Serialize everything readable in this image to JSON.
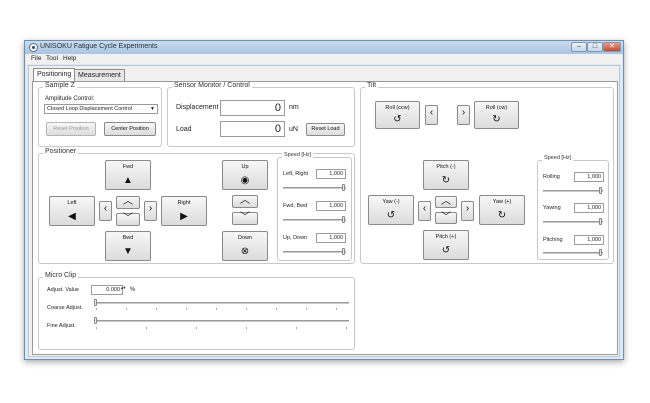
{
  "window": {
    "title": "UNISOKU Fatigue Cycle Experiments",
    "min_glyph": "–",
    "max_glyph": "□",
    "close_glyph": "✕"
  },
  "menu": [
    "File",
    "Tool",
    "Help"
  ],
  "tabs": [
    "Positioning",
    "Measurement"
  ],
  "sample_z": {
    "title": "Sample Z",
    "amp_label": "Amplitude Control:",
    "amp_value": "Closed Loop Displacement Control",
    "reset_position": "Reset Position",
    "center_position": "Center Position"
  },
  "sensor": {
    "title": "Sensor Monitor / Control",
    "displacement_label": "Displacement",
    "displacement_value": "0",
    "displacement_unit": "nm",
    "load_label": "Load",
    "load_value": "0",
    "load_unit": "uN",
    "reset_load": "Reset Load"
  },
  "tilt": {
    "title": "Tilt",
    "roll_ccw": "Roll (ccw)",
    "roll_cw": "Roll (cw)",
    "pitch_minus": "Pitch (-)",
    "pitch_plus": "Pitch (+)",
    "yaw_minus": "Yaw (-)",
    "yaw_plus": "Yaw (+)",
    "speed_title": "Speed [Hz]",
    "rolling_label": "Rolling",
    "rolling_value": "1,000",
    "yawing_label": "Yawing",
    "yawing_value": "1,000",
    "pitching_label": "Pitching",
    "pitching_value": "1,000"
  },
  "positioner": {
    "title": "Positioner",
    "fwd": "Fwd",
    "bwd": "Bwd",
    "left": "Left",
    "right": "Right",
    "up": "Up",
    "down": "Down",
    "speed_title": "Speed [Hz]",
    "lr_label": "Left, Right",
    "lr_value": "1,000",
    "fb_label": "Fwd, Bwd",
    "fb_value": "1,000",
    "ud_label": "Up, Down",
    "ud_value": "1,000"
  },
  "micro_clip": {
    "title": "Micro Clip",
    "adjust_label": "Adjust. Value",
    "adjust_value": "0.000",
    "adjust_unit": "%",
    "coarse_label": "Coarse Adjust.",
    "fine_label": "Fine Adjust."
  },
  "icons": {
    "up_arrow": "▲",
    "down_arrow": "▼",
    "left_arrow": "◀",
    "right_arrow": "▶",
    "chev_left": "‹",
    "chev_right": "›",
    "chev_up": "︿",
    "chev_down": "﹀",
    "rotate_ccw": "↺",
    "rotate_cw": "↻",
    "target": "◉",
    "cross_circle": "⊗",
    "spin": "▴▾"
  }
}
